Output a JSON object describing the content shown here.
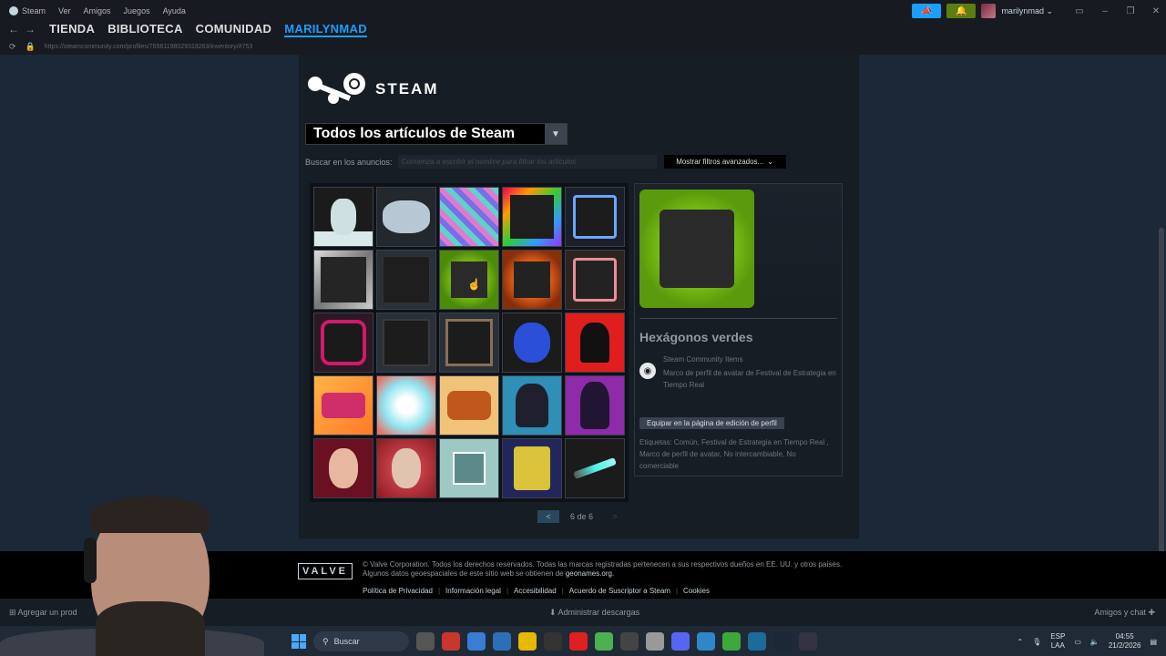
{
  "topbar": {
    "menu": [
      "Steam",
      "Ver",
      "Amigos",
      "Juegos",
      "Ayuda"
    ],
    "user_name": "marilynmad ⌄"
  },
  "nav": {
    "tabs": [
      "TIENDA",
      "BIBLIOTECA",
      "COMUNIDAD",
      "MARILYNMAD"
    ],
    "active_tab": "MARILYNMAD",
    "url": "https://steamcommunity.com/profiles/76561198029319263/inventory/#753"
  },
  "inventory": {
    "logo_text": "STEAM",
    "dropdown_label": "Todos los artículos de Steam",
    "search_label": "Buscar en los anuncios:",
    "search_placeholder": "Comienza a escribir el nombre para filtrar los artículos",
    "filters_button": "Mostrar filtros avanzados...",
    "grid_items": [
      "snowman",
      "elephant",
      "city",
      "frame-rainbow",
      "frame-blue",
      "frame-silver",
      "frame-dark",
      "frame-hexgreen",
      "frame-hexorange",
      "frame-pink",
      "frame-magenta",
      "frame-thin",
      "frame-wood",
      "sonic",
      "redchar",
      "gun",
      "burst",
      "logs",
      "anime-blue",
      "anime-purple",
      "vamp",
      "oldman",
      "forest",
      "yellow",
      "sword"
    ],
    "selected_index": 7,
    "pager": {
      "prev": "<",
      "text": "6 de 6",
      "next": ">"
    }
  },
  "detail": {
    "name": "Hexágonos verdes",
    "game": "Steam Community Items",
    "type": "Marco de perfil de avatar de Festival de Estrategia en Tiempo Real",
    "equip_button": "Equipar en la página de edición de perfil",
    "tags": "Etiquetas: Común, Festival de Estrategia en Tiempo Real , Marco de perfil de avatar, No intercambiable, No comerciable"
  },
  "footer": {
    "valve": "VALVE",
    "legal_1": "© Valve Corporation. Todos los derechos reservados. Todas las marcas registradas pertenecen a sus respectivos dueños en EE. UU. y otros países.",
    "legal_2": "Algunos datos geoespaciales de este sitio web se obtienen de",
    "legal_link": "geonames.org.",
    "links": [
      "Política de Privacidad",
      "Información legal",
      "Accesibilidad",
      "Acuerdo de Suscriptor a Steam",
      "Cookies"
    ]
  },
  "clientbar": {
    "add_game": "Agregar un prod",
    "downloads": "Administrar descargas",
    "friends": "Amigos y chat"
  },
  "taskbar": {
    "search": "Buscar",
    "lang": "ESP",
    "lang2": "LAA",
    "time": "04:55",
    "date": "21/2/2026"
  },
  "colors": {
    "accent": "#1a9fff",
    "background": "#1b2838",
    "panel": "#171d25"
  }
}
